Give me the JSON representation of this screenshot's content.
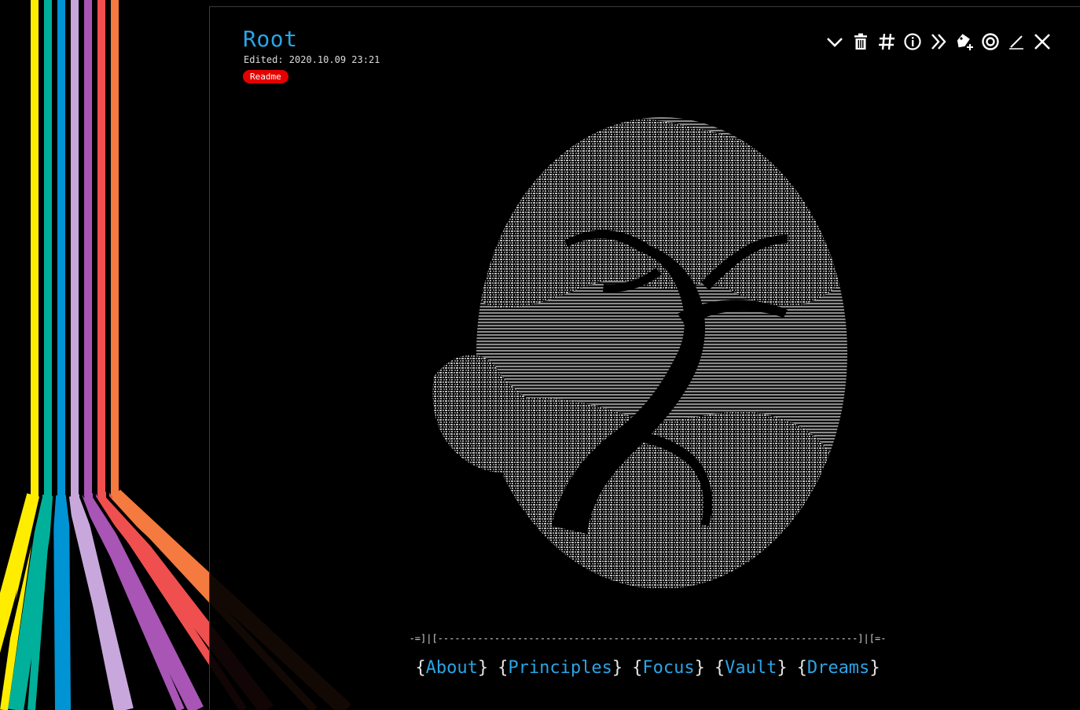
{
  "note": {
    "title": "Root",
    "edited": "Edited: 2020.10.09 23:21",
    "tag": "Readme"
  },
  "toolbar": {
    "icons": [
      "chevron-down-icon",
      "trash-icon",
      "hash-icon",
      "info-icon",
      "double-chevron-right-icon",
      "tag-add-icon",
      "target-icon",
      "pen-icon",
      "close-icon"
    ]
  },
  "divider": "-=]|[--------------------------------------------------------------------------]|[=-",
  "nav": {
    "links": [
      "About",
      "Principles",
      "Focus",
      "Vault",
      "Dreams"
    ]
  },
  "colors": {
    "accent": "#2aa4e6",
    "tag": "#e50000",
    "stripes": [
      "#ffed00",
      "#00b09b",
      "#0094d4",
      "#c8a8dc",
      "#a855b5",
      "#f04f4f",
      "#f47a3f"
    ]
  }
}
